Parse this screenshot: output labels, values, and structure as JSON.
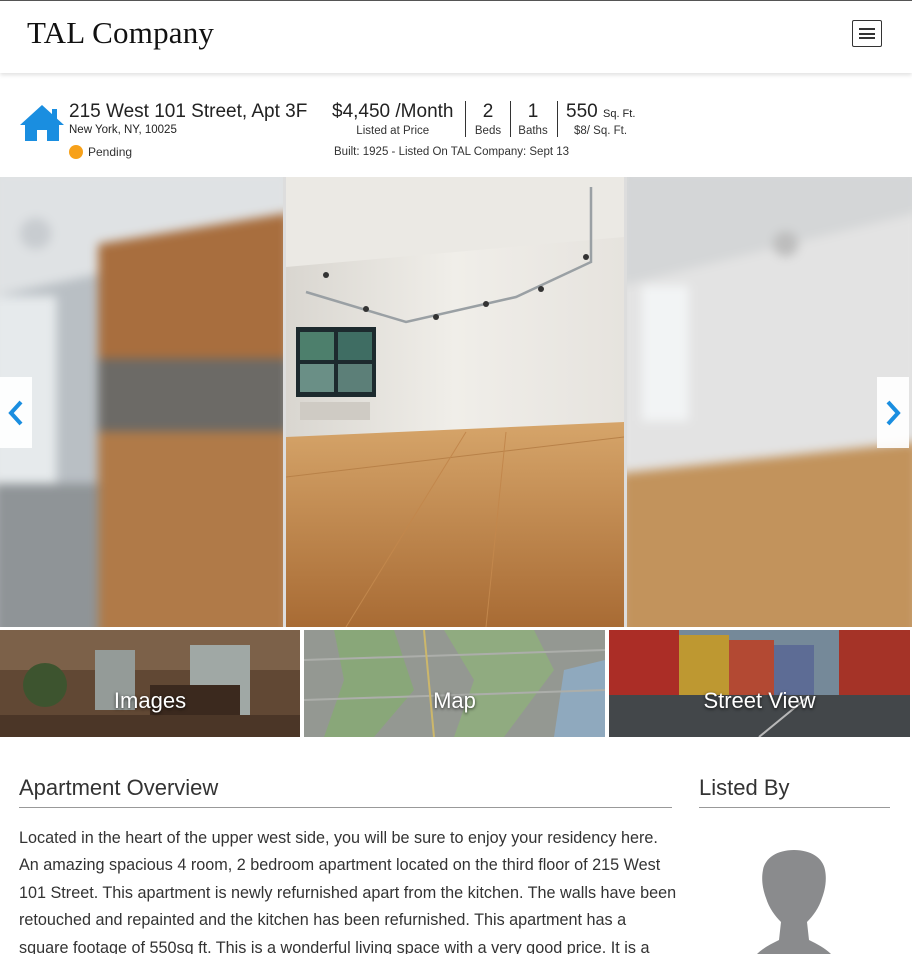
{
  "header": {
    "brand": "TAL Company",
    "menu_icon": "hamburger-menu-icon"
  },
  "listing": {
    "icon": "home-icon",
    "address": "215 West 101 Street, Apt 3F",
    "city": "New York, NY, 10025",
    "status": "Pending",
    "status_color": "#f7a11a",
    "price": "$4,450 /Month",
    "price_label": "Listed at Price",
    "beds": "2",
    "beds_label": "Beds",
    "baths": "1",
    "baths_label": "Baths",
    "sqft": "550",
    "sqft_unit": "Sq. Ft.",
    "price_per_sqft": "$8/ Sq. Ft.",
    "built_line": "Built: 1925 - Listed On TAL Company: Sept 13"
  },
  "gallery": {
    "prev_icon": "chevron-left-icon",
    "next_icon": "chevron-right-icon",
    "accent": "#1a8ee0"
  },
  "tiles": [
    {
      "label": "Images"
    },
    {
      "label": "Map"
    },
    {
      "label": "Street View"
    }
  ],
  "overview": {
    "title": "Apartment Overview",
    "text": "Located in the heart of the upper west side, you will be sure to enjoy your residency here. An amazing spacious 4 room, 2 bedroom apartment located on the third floor of 215 West 101 Street. This apartment is newly refurnished apart from the kitchen. The walls have been retouched and repainted and the kitchen has been refurnished. This apartment has a square footage of 550sq ft. This is a wonderful living space with a very good price. It is a great"
  },
  "listed_by": {
    "title": "Listed By",
    "avatar_icon": "person-silhouette-icon"
  }
}
